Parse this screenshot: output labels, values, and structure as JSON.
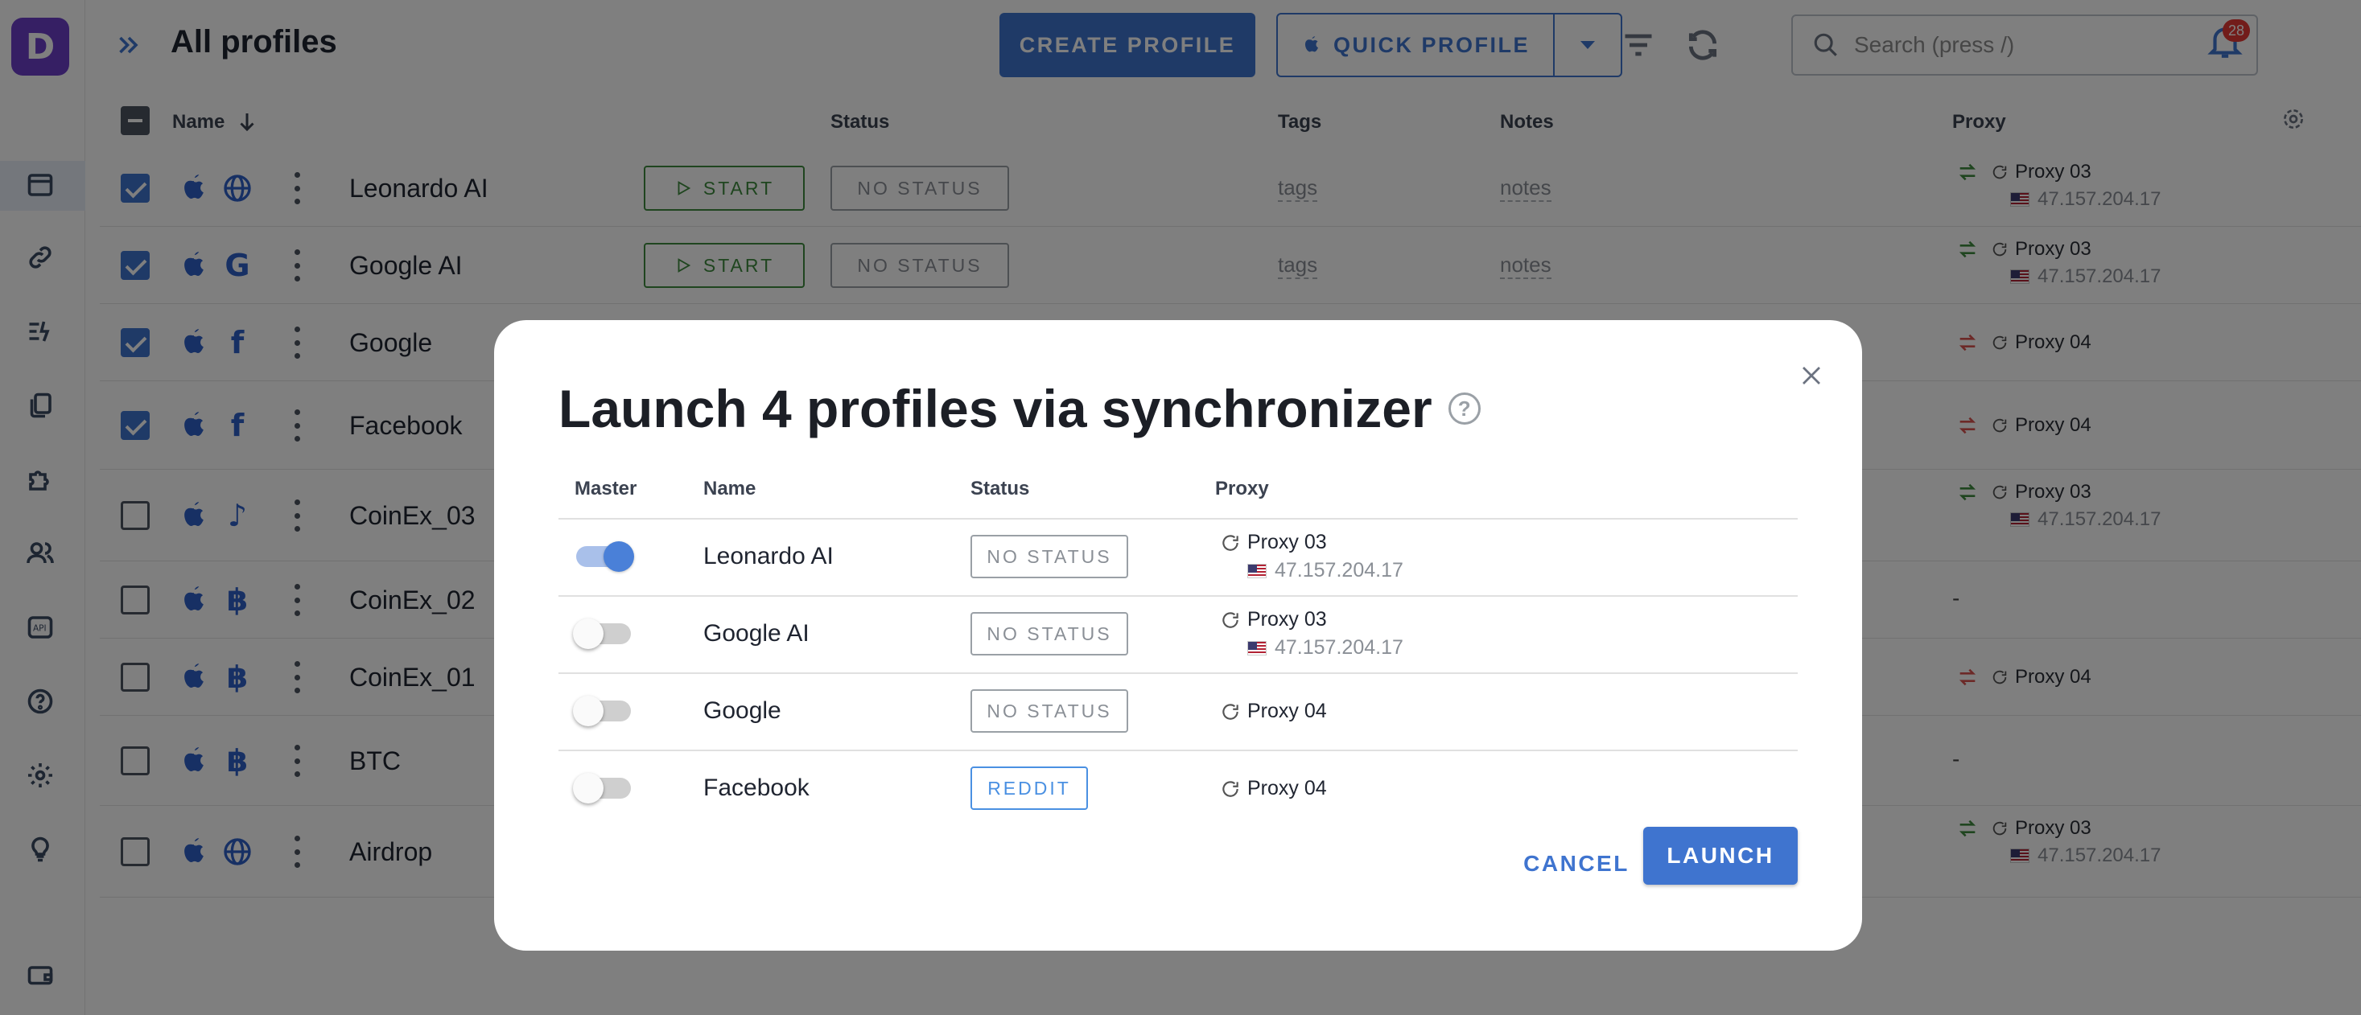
{
  "header": {
    "title": "All profiles",
    "create_profile_label": "CREATE PROFILE",
    "quick_profile_label": "QUICK PROFILE",
    "search_placeholder": "Search (press /)",
    "notifications_count": "28"
  },
  "table": {
    "columns": {
      "name": "Name",
      "status": "Status",
      "tags": "Tags",
      "notes": "Notes",
      "proxy": "Proxy"
    },
    "start_label": "START",
    "no_status_label": "NO STATUS",
    "tags_placeholder": "tags",
    "notes_placeholder": "notes",
    "rows": [
      {
        "name": "Leonardo AI",
        "browser": "globe-icon",
        "checked": true,
        "proxy": "Proxy 03",
        "ip": "47.157.204.17"
      },
      {
        "name": "Google AI",
        "browser": "google-icon",
        "checked": true,
        "proxy": "Proxy 03",
        "ip": "47.157.204.17"
      },
      {
        "name": "Google",
        "browser": "facebook-icon",
        "checked": true,
        "proxy": "Proxy 04",
        "ip": ""
      },
      {
        "name": "Facebook",
        "browser": "facebook-icon",
        "checked": true,
        "proxy": "Proxy 04",
        "ip": ""
      },
      {
        "name": "CoinEx_03",
        "browser": "tiktok-icon",
        "checked": false,
        "proxy": "Proxy 03",
        "ip": "47.157.204.17"
      },
      {
        "name": "CoinEx_02",
        "browser": "bitcoin-icon",
        "checked": false,
        "proxy": "-",
        "ip": ""
      },
      {
        "name": "CoinEx_01",
        "browser": "bitcoin-icon",
        "checked": false,
        "proxy": "Proxy 04",
        "ip": ""
      },
      {
        "name": "BTC",
        "browser": "bitcoin-icon",
        "checked": false,
        "proxy": "-",
        "ip": ""
      },
      {
        "name": "Airdrop",
        "browser": "globe-icon",
        "checked": false,
        "proxy": "Proxy 03",
        "ip": "47.157.204.17"
      }
    ]
  },
  "dialog": {
    "title": "Launch 4 profiles via synchronizer",
    "columns": {
      "master": "Master",
      "name": "Name",
      "status": "Status",
      "proxy": "Proxy"
    },
    "rows": [
      {
        "name": "Leonardo AI",
        "master": true,
        "status": "NO STATUS",
        "proxy": "Proxy 03",
        "ip": "47.157.204.17"
      },
      {
        "name": "Google AI",
        "master": false,
        "status": "NO STATUS",
        "proxy": "Proxy 03",
        "ip": "47.157.204.17"
      },
      {
        "name": "Google",
        "master": false,
        "status": "NO STATUS",
        "proxy": "Proxy 04",
        "ip": ""
      },
      {
        "name": "Facebook",
        "master": false,
        "status": "REDDIT",
        "proxy": "Proxy 04",
        "ip": ""
      }
    ],
    "cancel_label": "CANCEL",
    "launch_label": "LAUNCH"
  },
  "colors": {
    "accent": "#3f74cf",
    "brand": "#6c3fc9",
    "start_green": "#3e8b3e",
    "reddit_blue": "#4a90e2"
  }
}
